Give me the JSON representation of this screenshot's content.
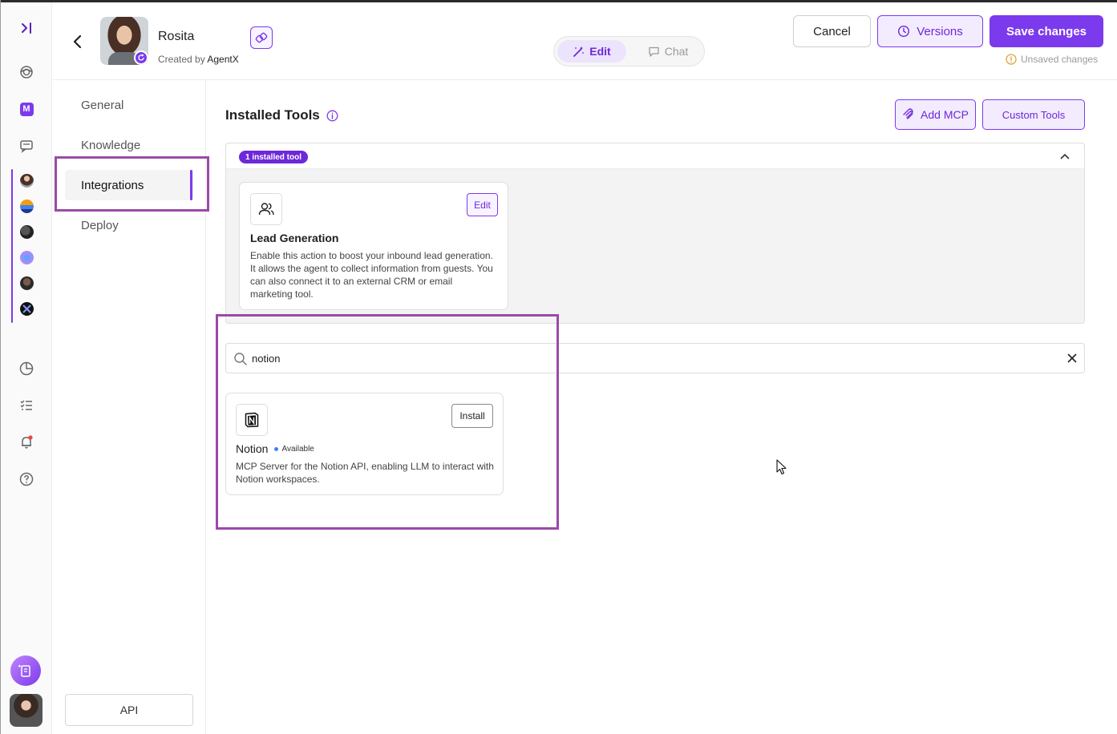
{
  "header": {
    "agent_name": "Rosita",
    "created_by_prefix": "Created by",
    "created_by_name": "AgentX",
    "mode_edit": "Edit",
    "mode_chat": "Chat",
    "cancel_label": "Cancel",
    "versions_label": "Versions",
    "save_label": "Save changes",
    "unsaved_text": "Unsaved changes"
  },
  "settings_nav": {
    "items": [
      {
        "label": "General"
      },
      {
        "label": "Knowledge"
      },
      {
        "label": "Integrations",
        "active": true
      },
      {
        "label": "Deploy"
      }
    ],
    "api_label": "API"
  },
  "main": {
    "installed_title": "Installed Tools",
    "add_mcp_label": "Add MCP",
    "custom_tools_label": "Custom Tools",
    "installed_count_badge": "1 installed tool",
    "installed_tools": [
      {
        "name": "Lead Generation",
        "icon": "users-icon",
        "edit_label": "Edit",
        "description": "Enable this action to boost your inbound lead generation. It allows the agent to collect information from guests. You can also connect it to an external CRM or email marketing tool."
      }
    ],
    "search": {
      "value": "notion",
      "placeholder": ""
    },
    "results": [
      {
        "name": "Notion",
        "icon": "notion-icon",
        "status": "Available",
        "install_label": "Install",
        "description": "MCP Server for the Notion API, enabling LLM to interact with Notion workspaces."
      }
    ]
  },
  "colors": {
    "accent": "#7c3aed",
    "accent_soft": "#f3ecff",
    "highlight_border": "#9b4aa8",
    "status_dot": "#3b82f6",
    "unsaved": "#e0a33a"
  }
}
